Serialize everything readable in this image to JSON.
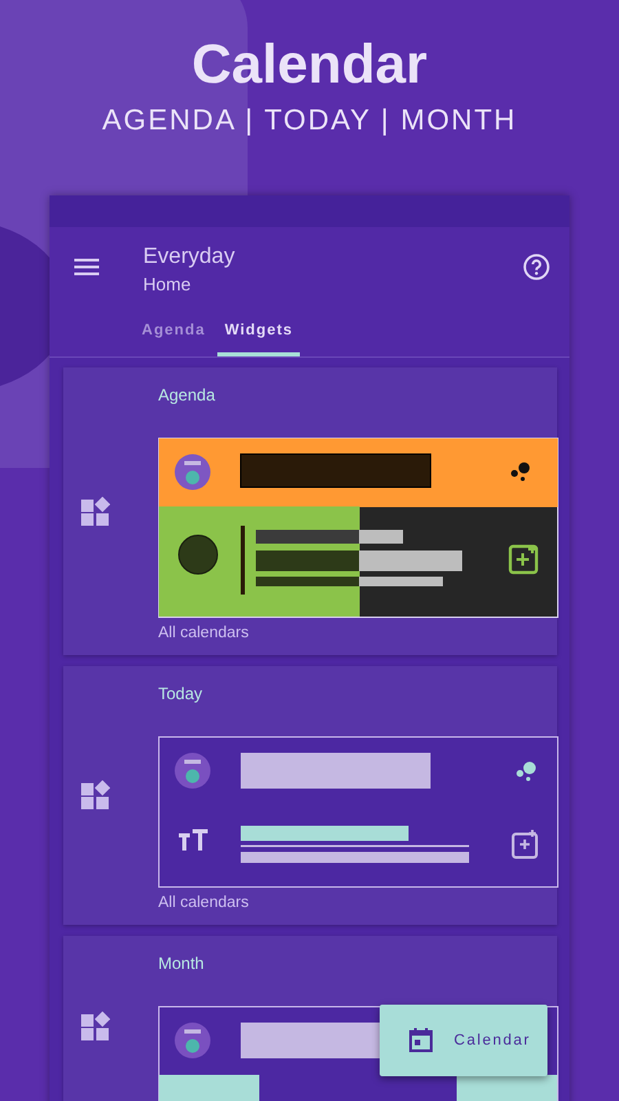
{
  "header": {
    "title": "Calendar",
    "subtitle": "AGENDA | TODAY | MONTH"
  },
  "app_bar": {
    "title": "Everyday",
    "subtitle": "Home"
  },
  "tabs": [
    {
      "label": "Agenda",
      "selected": false
    },
    {
      "label": "Widgets",
      "selected": true
    }
  ],
  "widgets": [
    {
      "kind": "agenda",
      "title": "Agenda",
      "caption": "All calendars"
    },
    {
      "kind": "today",
      "title": "Today",
      "caption": "All calendars"
    },
    {
      "kind": "month",
      "title": "Month"
    }
  ],
  "fab": {
    "label": "Calendar"
  }
}
